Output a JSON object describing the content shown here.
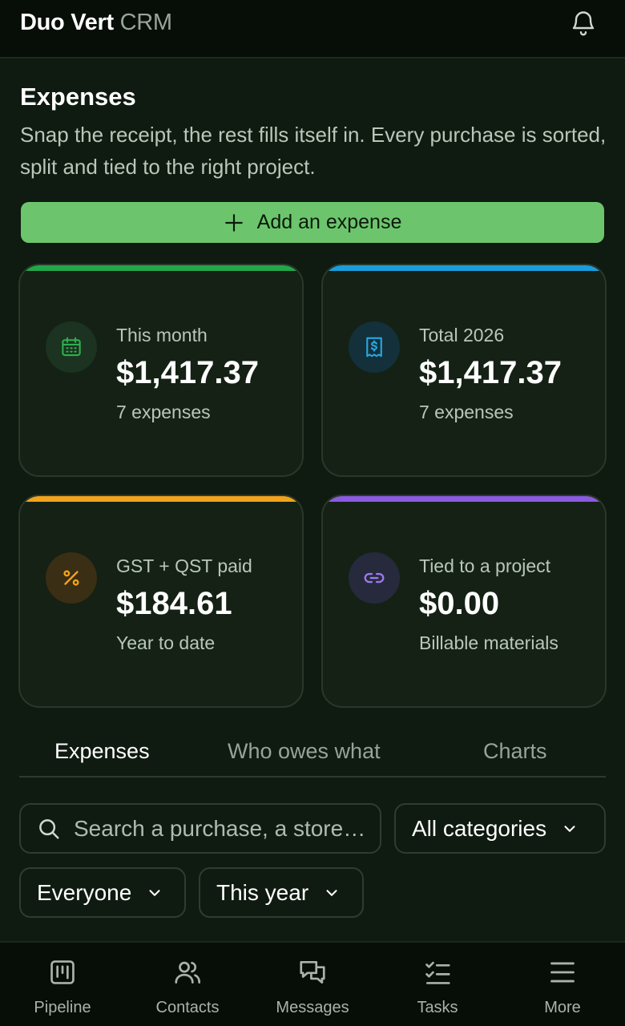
{
  "app": {
    "brand_bold": "Duo Vert",
    "brand_light": "CRM"
  },
  "page": {
    "title": "Expenses",
    "subtitle": "Snap the receipt, the rest fills itself in. Every purchase is sorted, split and tied to the right project."
  },
  "actions": {
    "add_label": "Add an expense",
    "add_icon": "plus-icon"
  },
  "cards": [
    {
      "label": "This month",
      "value": "$1,417.37",
      "note": "7 expenses",
      "icon": "calendar-icon",
      "accent": "#22a64b"
    },
    {
      "label": "Total 2026",
      "value": "$1,417.37",
      "note": "7 expenses",
      "icon": "receipt-icon",
      "accent": "#1a9ddc"
    },
    {
      "label": "GST + QST paid",
      "value": "$184.61",
      "note": "Year to date",
      "icon": "percent-icon",
      "accent": "#f2a21b"
    },
    {
      "label": "Tied to a project",
      "value": "$0.00",
      "note": "Billable materials",
      "icon": "link-icon",
      "accent": "#8b5ae0"
    }
  ],
  "tabs": [
    {
      "label": "Expenses",
      "active": true
    },
    {
      "label": "Who owes what",
      "active": false
    },
    {
      "label": "Charts",
      "active": false
    }
  ],
  "filters": {
    "search_placeholder": "Search a purchase, a store…",
    "category": "All categories",
    "person": "Everyone",
    "period": "This year"
  },
  "nav": [
    {
      "label": "Pipeline",
      "icon": "pipeline-icon"
    },
    {
      "label": "Contacts",
      "icon": "contacts-icon"
    },
    {
      "label": "Messages",
      "icon": "messages-icon"
    },
    {
      "label": "Tasks",
      "icon": "tasks-icon"
    },
    {
      "label": "More",
      "icon": "menu-icon"
    }
  ],
  "colors": {
    "accent_green": "#6cc56c",
    "background": "#0f1a10",
    "card": "#142114"
  }
}
